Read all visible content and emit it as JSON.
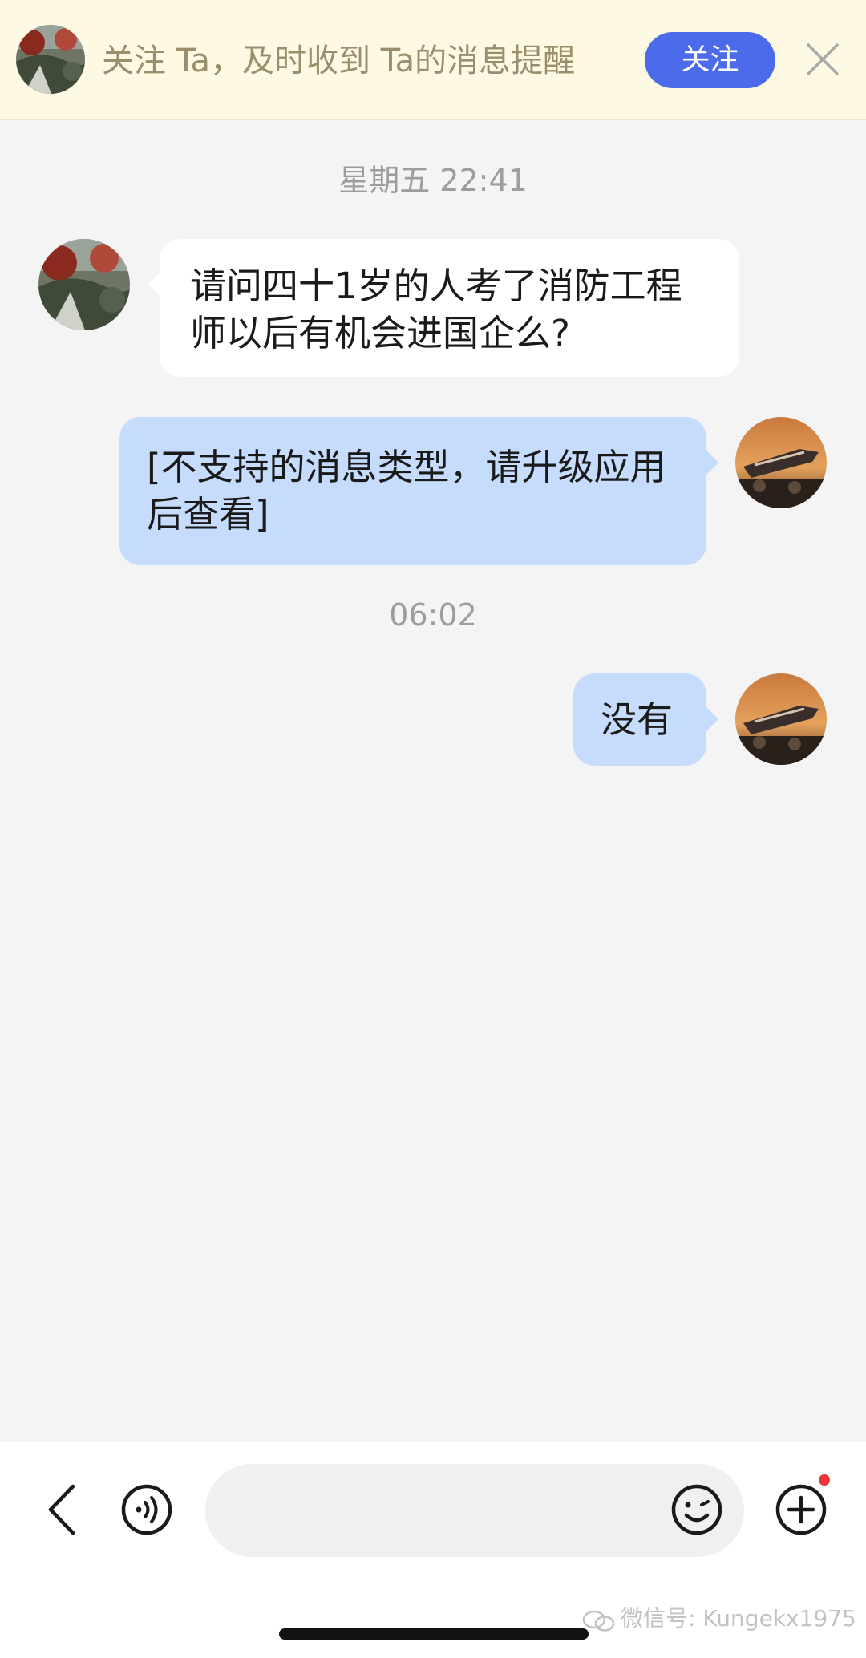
{
  "banner": {
    "text": "关注 Ta，及时收到 Ta的消息提醒",
    "follow_label": "关注",
    "avatar_icon": "landscape-avatar"
  },
  "timestamps": [
    "星期五 22:41",
    "06:02"
  ],
  "messages": [
    {
      "from": "other",
      "text": "请问四十1岁的人考了消防工程师以后有机会进国企么?"
    },
    {
      "from": "me",
      "text": "[不支持的消息类型，请升级应用后查看]"
    },
    {
      "from": "me",
      "text": "没有"
    }
  ],
  "input": {
    "value": "",
    "placeholder": ""
  },
  "icons": {
    "back": "chevron-left-icon",
    "voice": "voice-icon",
    "emoji": "emoji-icon",
    "plus": "plus-icon",
    "close": "close-icon"
  },
  "colors": {
    "banner_bg": "#fdf9e2",
    "follow_button": "#4c6bea",
    "outgoing_bubble": "#c5dcfd",
    "incoming_bubble": "#ffffff",
    "notification_dot": "#f0343b"
  },
  "watermark": "微信号: Kungekx1975"
}
